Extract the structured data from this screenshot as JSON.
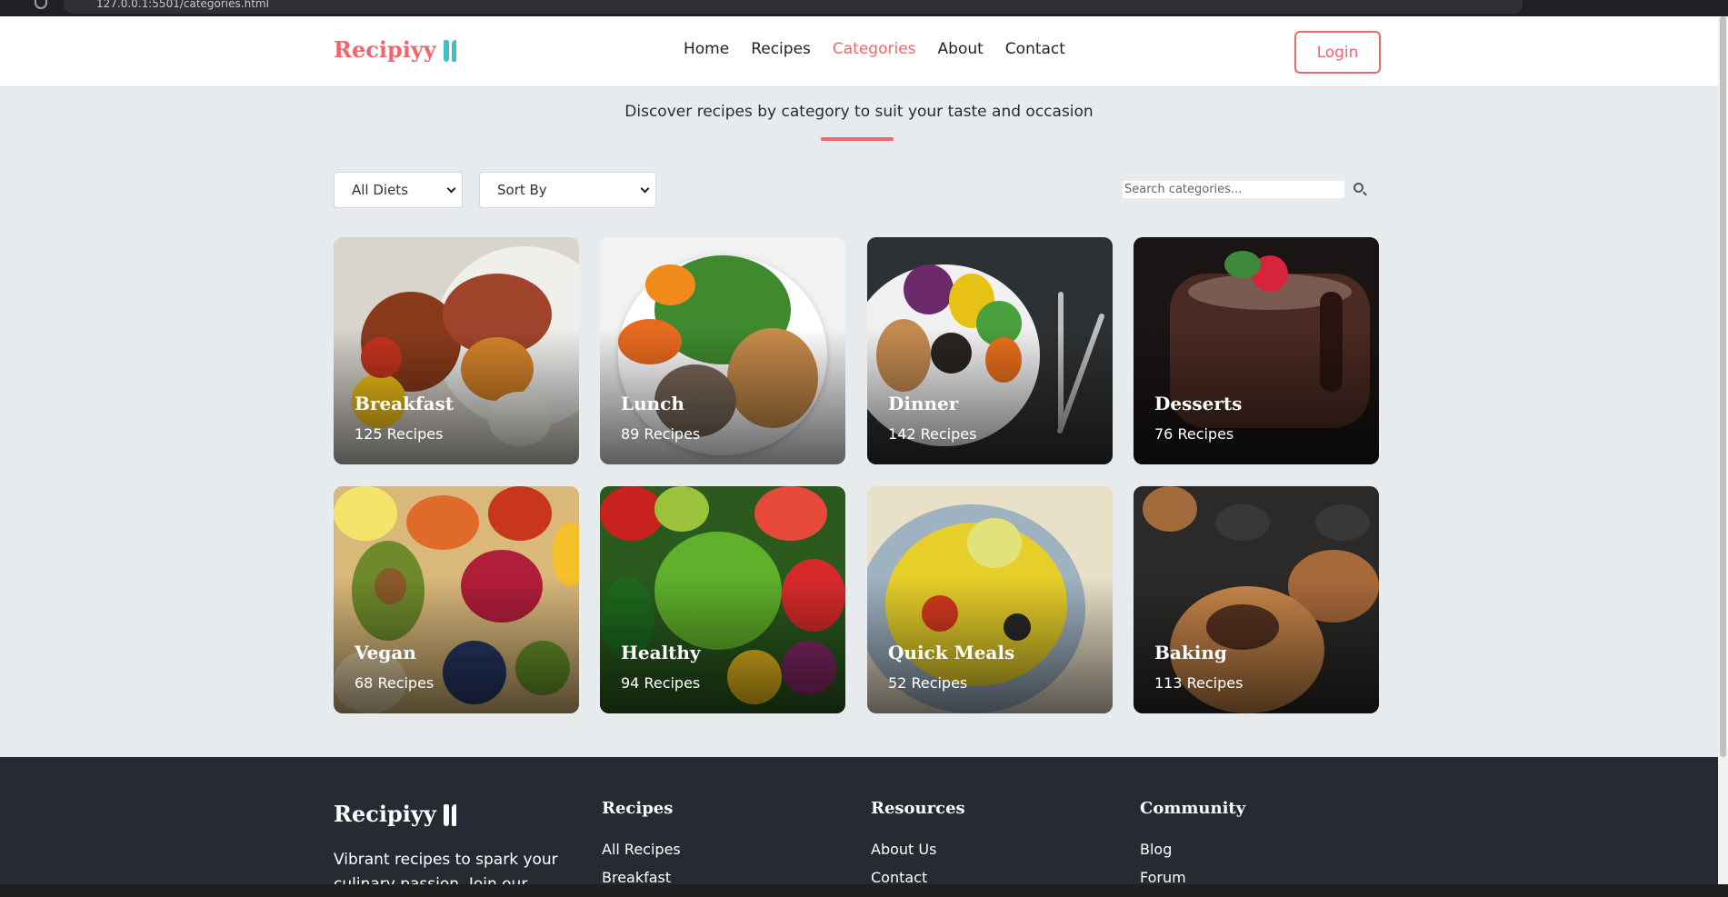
{
  "browser": {
    "url": "127.0.0.1:5501/categories.html"
  },
  "header": {
    "logo": "Recipiyy",
    "nav": [
      "Home",
      "Recipes",
      "Categories",
      "About",
      "Contact"
    ],
    "active": "Categories",
    "login": "Login"
  },
  "subtitle": "Discover recipes by category to suit your taste and occasion",
  "filters": {
    "diet": "All Diets",
    "sort": "Sort By",
    "search_placeholder": "Search categories..."
  },
  "categories": [
    {
      "name": "Breakfast",
      "count": "125 Recipes"
    },
    {
      "name": "Lunch",
      "count": "89 Recipes"
    },
    {
      "name": "Dinner",
      "count": "142 Recipes"
    },
    {
      "name": "Desserts",
      "count": "76 Recipes"
    },
    {
      "name": "Vegan",
      "count": "68 Recipes"
    },
    {
      "name": "Healthy",
      "count": "94 Recipes"
    },
    {
      "name": "Quick Meals",
      "count": "52 Recipes"
    },
    {
      "name": "Baking",
      "count": "113 Recipes"
    }
  ],
  "footer": {
    "logo": "Recipiyy",
    "tagline_1": "Vibrant recipes to spark your",
    "tagline_2": "culinary passion. Join our",
    "columns": [
      {
        "title": "Recipes",
        "links": [
          "All Recipes",
          "Breakfast"
        ]
      },
      {
        "title": "Resources",
        "links": [
          "About Us",
          "Contact"
        ]
      },
      {
        "title": "Community",
        "links": [
          "Blog",
          "Forum"
        ]
      }
    ]
  },
  "colors": {
    "accent": "#f0666c",
    "teal": "#3cc3c3",
    "footer_bg": "#262b33"
  }
}
